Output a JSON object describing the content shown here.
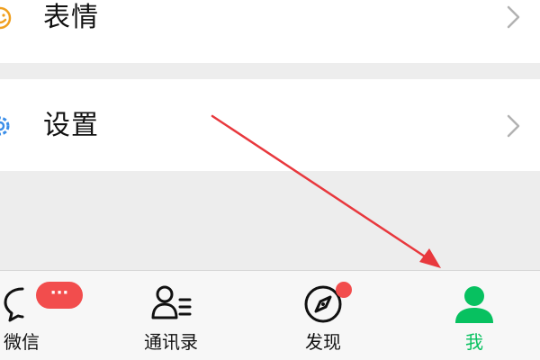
{
  "menu": {
    "emoji_label": "表情",
    "settings_label": "设置"
  },
  "tabs": {
    "chats_label": "微信",
    "contacts_label": "通讯录",
    "discover_label": "发现",
    "me_label": "我",
    "chats_badge": "···",
    "active": "me"
  },
  "colors": {
    "active_tab": "#07c160",
    "badge": "#f24d4d",
    "emoji_icon": "#f0a020",
    "settings_icon": "#3b8ee8",
    "annotation_arrow": "#e8383d"
  },
  "icons": {
    "emoji": "smiley-icon",
    "settings": "gear-icon",
    "chats": "chat-bubble-icon",
    "contacts": "contacts-icon",
    "discover": "compass-icon",
    "me": "person-icon"
  }
}
